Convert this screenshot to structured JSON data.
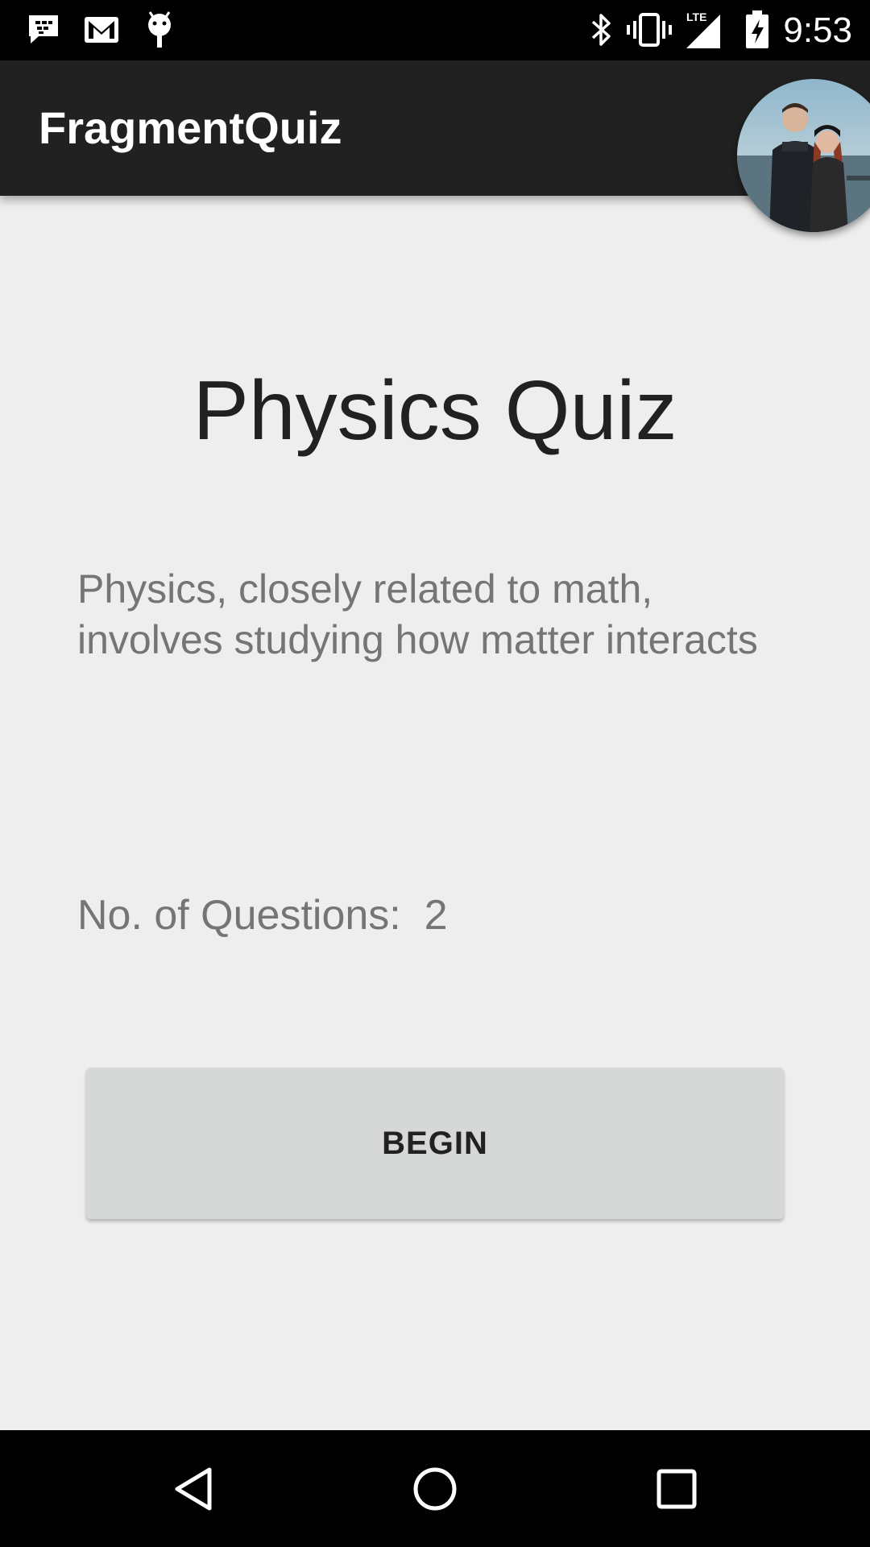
{
  "status_bar": {
    "time": "9:53",
    "left_icons": [
      "bbm-chat-icon",
      "gmail-icon",
      "android-debug-icon"
    ],
    "right_icons": [
      "bluetooth-icon",
      "vibrate-icon",
      "lte-signal-icon",
      "battery-charging-icon"
    ],
    "network_label": "LTE"
  },
  "app_bar": {
    "title": "FragmentQuiz",
    "background": "#212121"
  },
  "quiz": {
    "title": "Physics Quiz",
    "description": "Physics, closely related to math, involves studying how matter interacts",
    "question_count_label": "No. of Questions:  2",
    "begin_label": "BEGIN"
  },
  "nav_bar": {
    "icons": [
      "back-icon",
      "home-icon",
      "recents-icon"
    ]
  },
  "colors": {
    "background": "#eeeeee",
    "button": "#d6d7d7",
    "secondary_text": "#757575",
    "primary_text": "#212121"
  }
}
